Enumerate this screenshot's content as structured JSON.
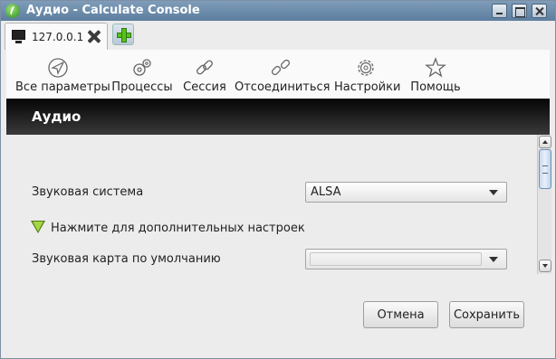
{
  "window": {
    "title": "Аудио - Calculate Console"
  },
  "tabs": [
    {
      "label": "127.0.0.1"
    }
  ],
  "toolbar": {
    "items": [
      {
        "label": "Все параметры",
        "icon": "compass-icon"
      },
      {
        "label": "Процессы",
        "icon": "gears-icon"
      },
      {
        "label": "Сессия",
        "icon": "link-icon"
      },
      {
        "label": "Отсоединиться",
        "icon": "broken-link-icon"
      },
      {
        "label": "Настройки",
        "icon": "gear-icon"
      },
      {
        "label": "Помощь",
        "icon": "star-icon"
      }
    ]
  },
  "page": {
    "title": "Аудио"
  },
  "form": {
    "sound_system_label": "Звуковая система",
    "sound_system_value": "ALSA",
    "advanced_toggle_label": "Нажмите для дополнительных настроек",
    "default_card_label": "Звуковая карта по умолчанию",
    "default_card_value": ""
  },
  "buttons": {
    "cancel": "Отмена",
    "save": "Сохранить"
  },
  "colors": {
    "header_bg": "#1a1a1a",
    "expander": "#8cc63f",
    "titlebar": "#6e8eaf"
  }
}
